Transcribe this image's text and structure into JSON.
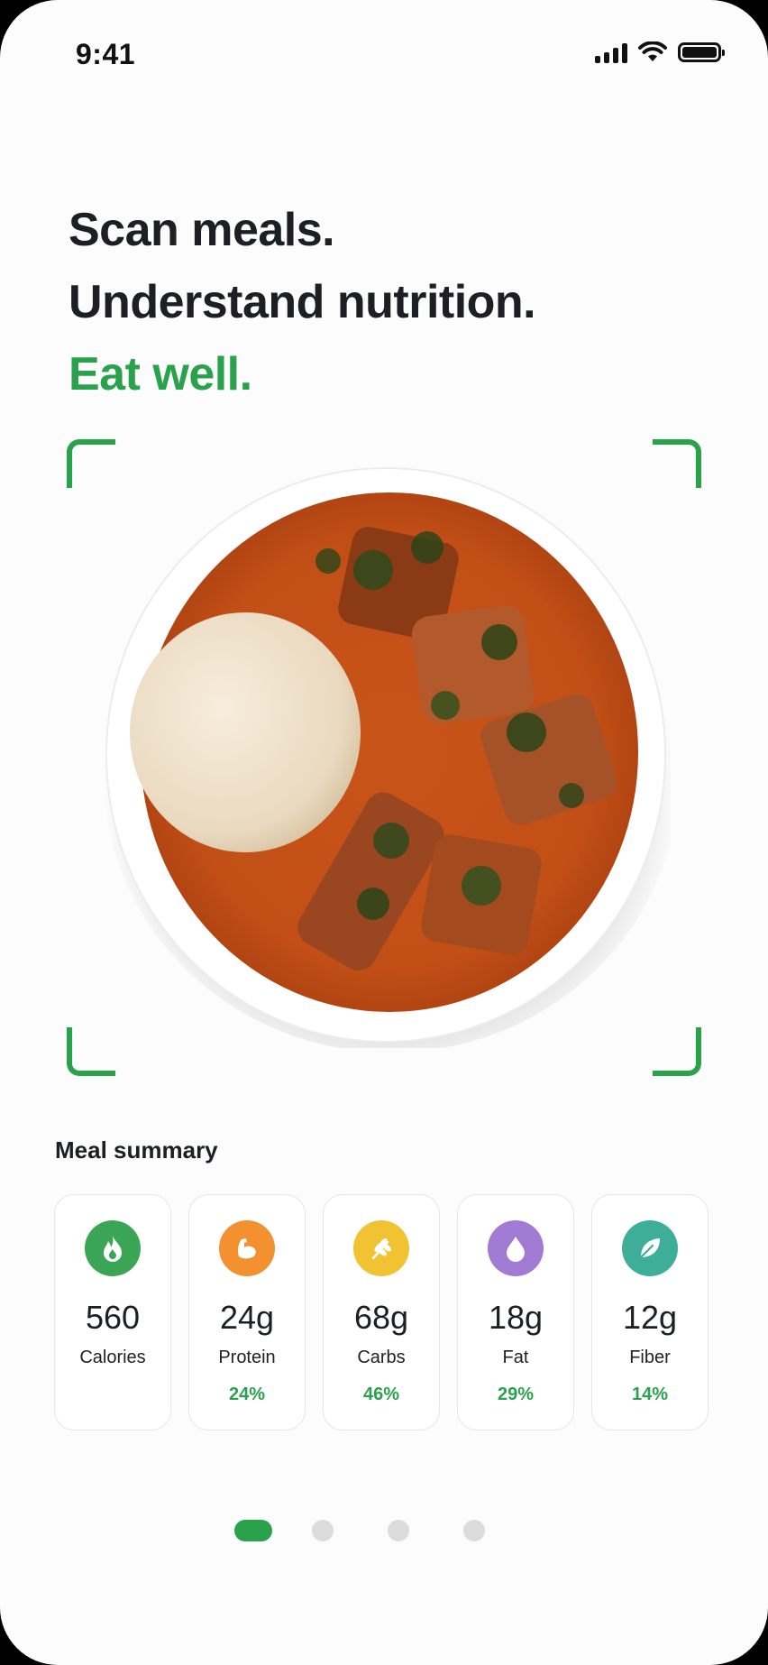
{
  "status_bar": {
    "time": "9:41"
  },
  "headline": {
    "line1": "Scan meals.",
    "line2": "Understand nutrition.",
    "line3": "Eat well."
  },
  "colors": {
    "accent": "#2aa24c",
    "calories": "#3aa655",
    "protein": "#f39130",
    "carbs": "#f1c232",
    "fat": "#a17ad4",
    "fiber": "#3fae98"
  },
  "summary": {
    "title": "Meal summary",
    "items": [
      {
        "icon": "flame-icon",
        "value": "560",
        "label": "Calories",
        "percent": ""
      },
      {
        "icon": "muscle-icon",
        "value": "24g",
        "label": "Protein",
        "percent": "24%"
      },
      {
        "icon": "wheat-icon",
        "value": "68g",
        "label": "Carbs",
        "percent": "46%"
      },
      {
        "icon": "droplet-icon",
        "value": "18g",
        "label": "Fat",
        "percent": "29%"
      },
      {
        "icon": "leaf-icon",
        "value": "12g",
        "label": "Fiber",
        "percent": "14%"
      }
    ]
  },
  "pager": {
    "pages": 4,
    "current": 1
  }
}
